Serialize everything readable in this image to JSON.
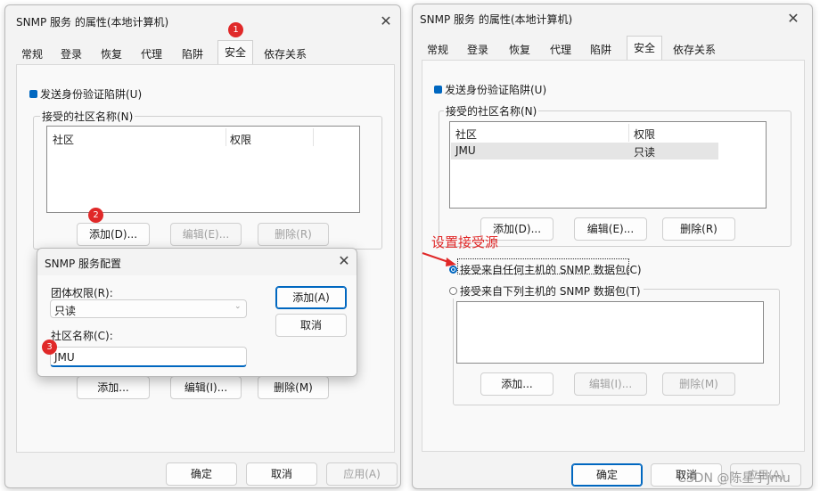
{
  "left": {
    "title": "SNMP 服务 的属性(本地计算机)",
    "tabs": [
      "常规",
      "登录",
      "恢复",
      "代理",
      "陷阱",
      "安全",
      "依存关系"
    ],
    "send_auth_trap": "发送身份验证陷阱(U)",
    "accepted_communities_label": "接受的社区名称(N)",
    "col_community": "社区",
    "col_rights": "权限",
    "add_button": "添加(D)...",
    "edit_button": "编辑(E)...",
    "remove_button": "删除(R)",
    "lower_add_button": "添加...",
    "lower_edit_button": "编辑(I)...",
    "lower_remove_button": "删除(M)",
    "ok_button": "确定",
    "cancel_button": "取消",
    "apply_button": "应用(A)",
    "badge1": "1",
    "badge2": "2",
    "badge3": "3"
  },
  "dialog": {
    "title": "SNMP 服务配置",
    "rights_label": "团体权限(R):",
    "rights_value": "只读",
    "name_label": "社区名称(C):",
    "name_value": "JMU",
    "add_button": "添加(A)",
    "cancel_button": "取消"
  },
  "right": {
    "title": "SNMP 服务 的属性(本地计算机)",
    "tabs": [
      "常规",
      "登录",
      "恢复",
      "代理",
      "陷阱",
      "安全",
      "依存关系"
    ],
    "send_auth_trap": "发送身份验证陷阱(U)",
    "accepted_communities_label": "接受的社区名称(N)",
    "col_community": "社区",
    "col_rights": "权限",
    "row_community": "JMU",
    "row_rights": "只读",
    "add_button": "添加(D)...",
    "edit_button": "编辑(E)...",
    "remove_button": "删除(R)",
    "annotation": "设置接受源",
    "accept_any": "接受来自任何主机的 SNMP 数据包(C)",
    "accept_listed": "接受来自下列主机的 SNMP 数据包(T)",
    "lower_add_button": "添加...",
    "lower_edit_button": "编辑(I)...",
    "lower_remove_button": "删除(M)",
    "ok_button": "确定",
    "cancel_button": "取消",
    "apply_button": "应用(A)",
    "watermark": "CSDN @陈星宇jmu"
  },
  "colors": {
    "accent": "#0067c0",
    "badge": "#e02828",
    "annotation": "#e02828"
  }
}
